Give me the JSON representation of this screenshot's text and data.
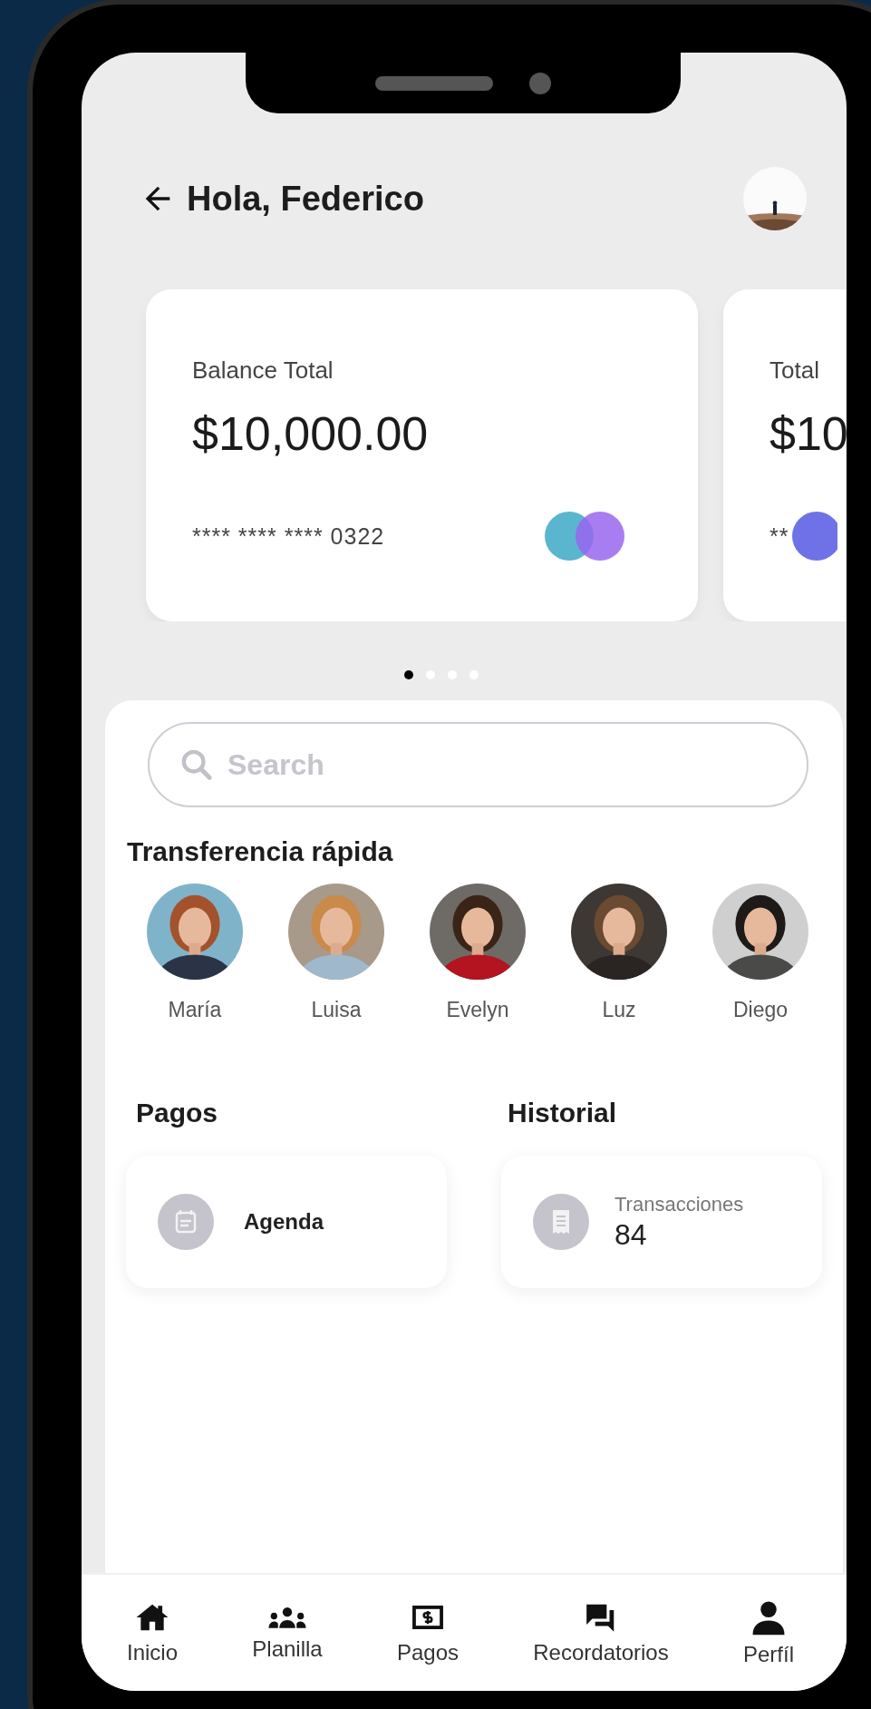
{
  "header": {
    "title": "Hola, Federico"
  },
  "cards": [
    {
      "label": "Balance Total",
      "amount": "$10,000.00",
      "number": "**** **** **** 0322",
      "kind": "pair"
    },
    {
      "label": "Total",
      "amount": "$10",
      "number": "**",
      "kind": "single"
    }
  ],
  "carousel_dots": [
    {
      "selected": true
    },
    {
      "selected": false
    },
    {
      "selected": false
    },
    {
      "selected": false
    }
  ],
  "search": {
    "placeholder": "Search"
  },
  "quick_transfer": {
    "title": "Transferencia rápida",
    "contacts": [
      {
        "name": "María"
      },
      {
        "name": "Luisa"
      },
      {
        "name": "Evelyn"
      },
      {
        "name": "Luz"
      },
      {
        "name": "Diego"
      }
    ]
  },
  "payments": {
    "title": "Pagos",
    "item": {
      "label": "Agenda"
    }
  },
  "history": {
    "title": "Historial",
    "item": {
      "label": "Transacciones",
      "value": "84"
    }
  },
  "nav": [
    {
      "label": "Inicio",
      "kind": "home"
    },
    {
      "label": "Planilla",
      "kind": "group"
    },
    {
      "label": "Pagos",
      "kind": "money"
    },
    {
      "label": "Recordatorios",
      "kind": "chat"
    },
    {
      "label": "Perfíl",
      "kind": "person"
    }
  ]
}
